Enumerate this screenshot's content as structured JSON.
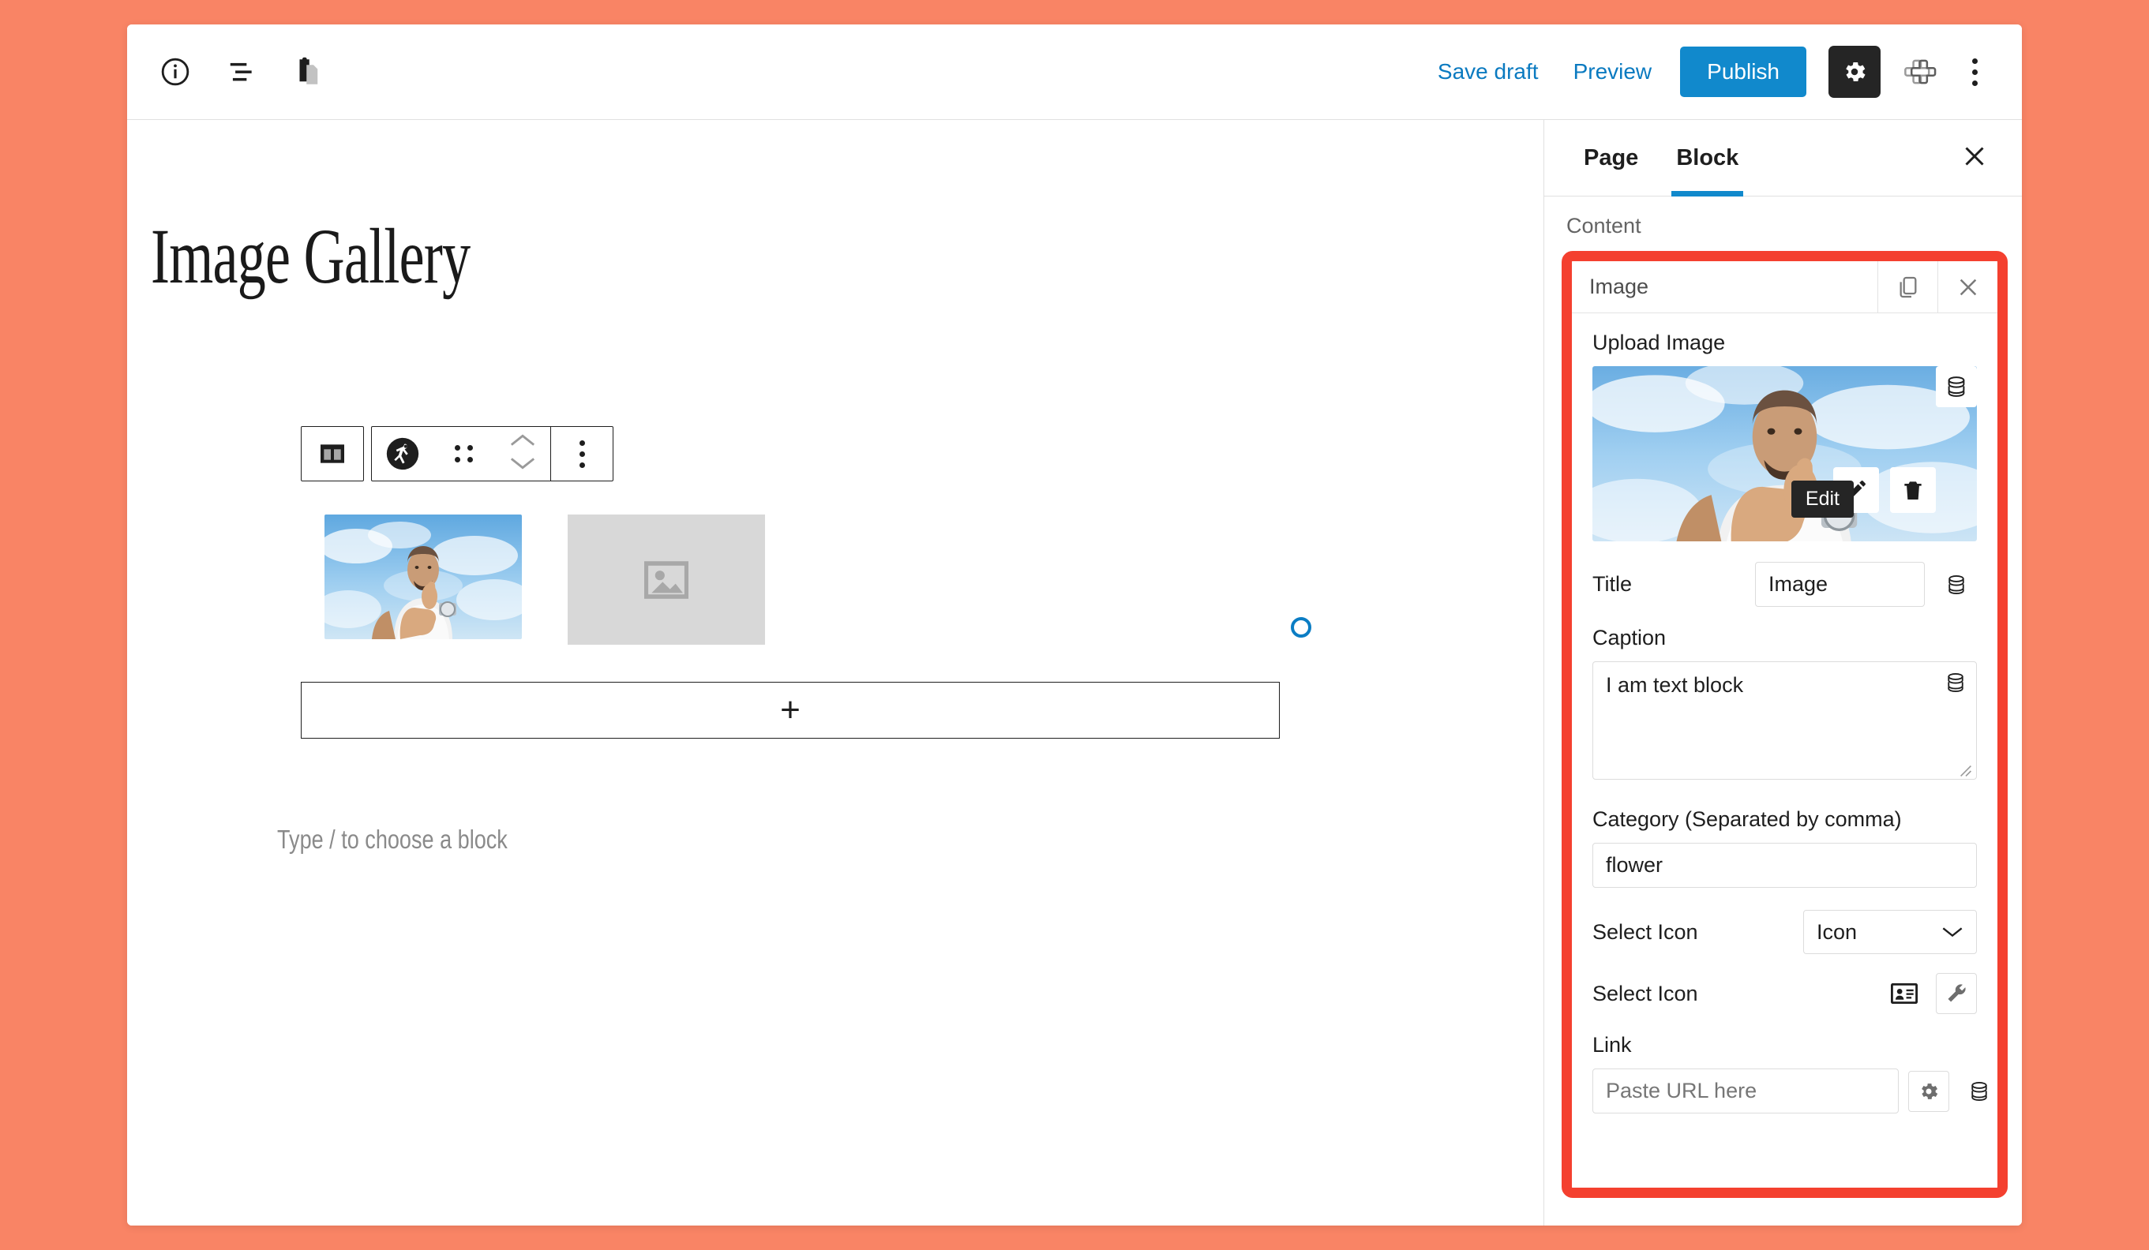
{
  "theme": {
    "page_background": "#f98465",
    "accent_blue": "#1189cc",
    "link_blue": "#0a7ac0",
    "highlight_red": "#f4402f",
    "dark": "#252525"
  },
  "topbar": {
    "left_icons": [
      {
        "name": "info-icon",
        "label": "Details"
      },
      {
        "name": "list-view-icon",
        "label": "List view"
      },
      {
        "name": "clipboard-icon",
        "label": "Copy"
      }
    ],
    "save_draft_label": "Save draft",
    "preview_label": "Preview",
    "publish_label": "Publish",
    "settings_label": "Settings",
    "plugin_label": "Plugin",
    "more_label": "Options"
  },
  "editor": {
    "post_title": "Image Gallery",
    "block_toolbar": {
      "block_type_label": "Columns",
      "astronaut_label": "Block",
      "drag_label": "Drag",
      "move_up_label": "Move up",
      "move_down_label": "Move down",
      "more_label": "Options"
    },
    "gallery": {
      "images": [
        {
          "name": "gallery-image-1",
          "alt": "Man giving thumbs up in front of blue sky"
        },
        {
          "name": "gallery-image-placeholder",
          "alt": "Empty image placeholder"
        }
      ]
    },
    "add_block_label": "+",
    "placeholder_text": "Type / to choose a block"
  },
  "sidebar": {
    "tabs": [
      {
        "label": "Page",
        "active": false
      },
      {
        "label": "Block",
        "active": true
      }
    ],
    "close_label": "Close settings",
    "section_label": "Content",
    "panel": {
      "title": "Image",
      "duplicate_label": "Duplicate",
      "close_label": "Remove",
      "upload_label": "Upload Image",
      "image_alt": "Man giving thumbs up in front of blue sky",
      "dynamic_data_label": "Dynamic data",
      "edit_button_label": "Edit",
      "delete_button_label": "Delete",
      "edit_tooltip": "Edit",
      "title_field": {
        "label": "Title",
        "value": "Image",
        "placeholder": ""
      },
      "caption_field": {
        "label": "Caption",
        "value": "I am text block",
        "placeholder": ""
      },
      "category_field": {
        "label": "Category (Separated by comma)",
        "value": "flower",
        "placeholder": ""
      },
      "select_icon_dropdown": {
        "label": "Select Icon",
        "value": "Icon",
        "options": [
          "Icon"
        ]
      },
      "select_icon_picker": {
        "label": "Select Icon",
        "icon_name": "id-card-icon",
        "tool_label": "Settings"
      },
      "link_field": {
        "label": "Link",
        "value": "",
        "placeholder": "Paste URL here",
        "settings_label": "Link settings",
        "dynamic_label": "Dynamic data"
      }
    }
  }
}
